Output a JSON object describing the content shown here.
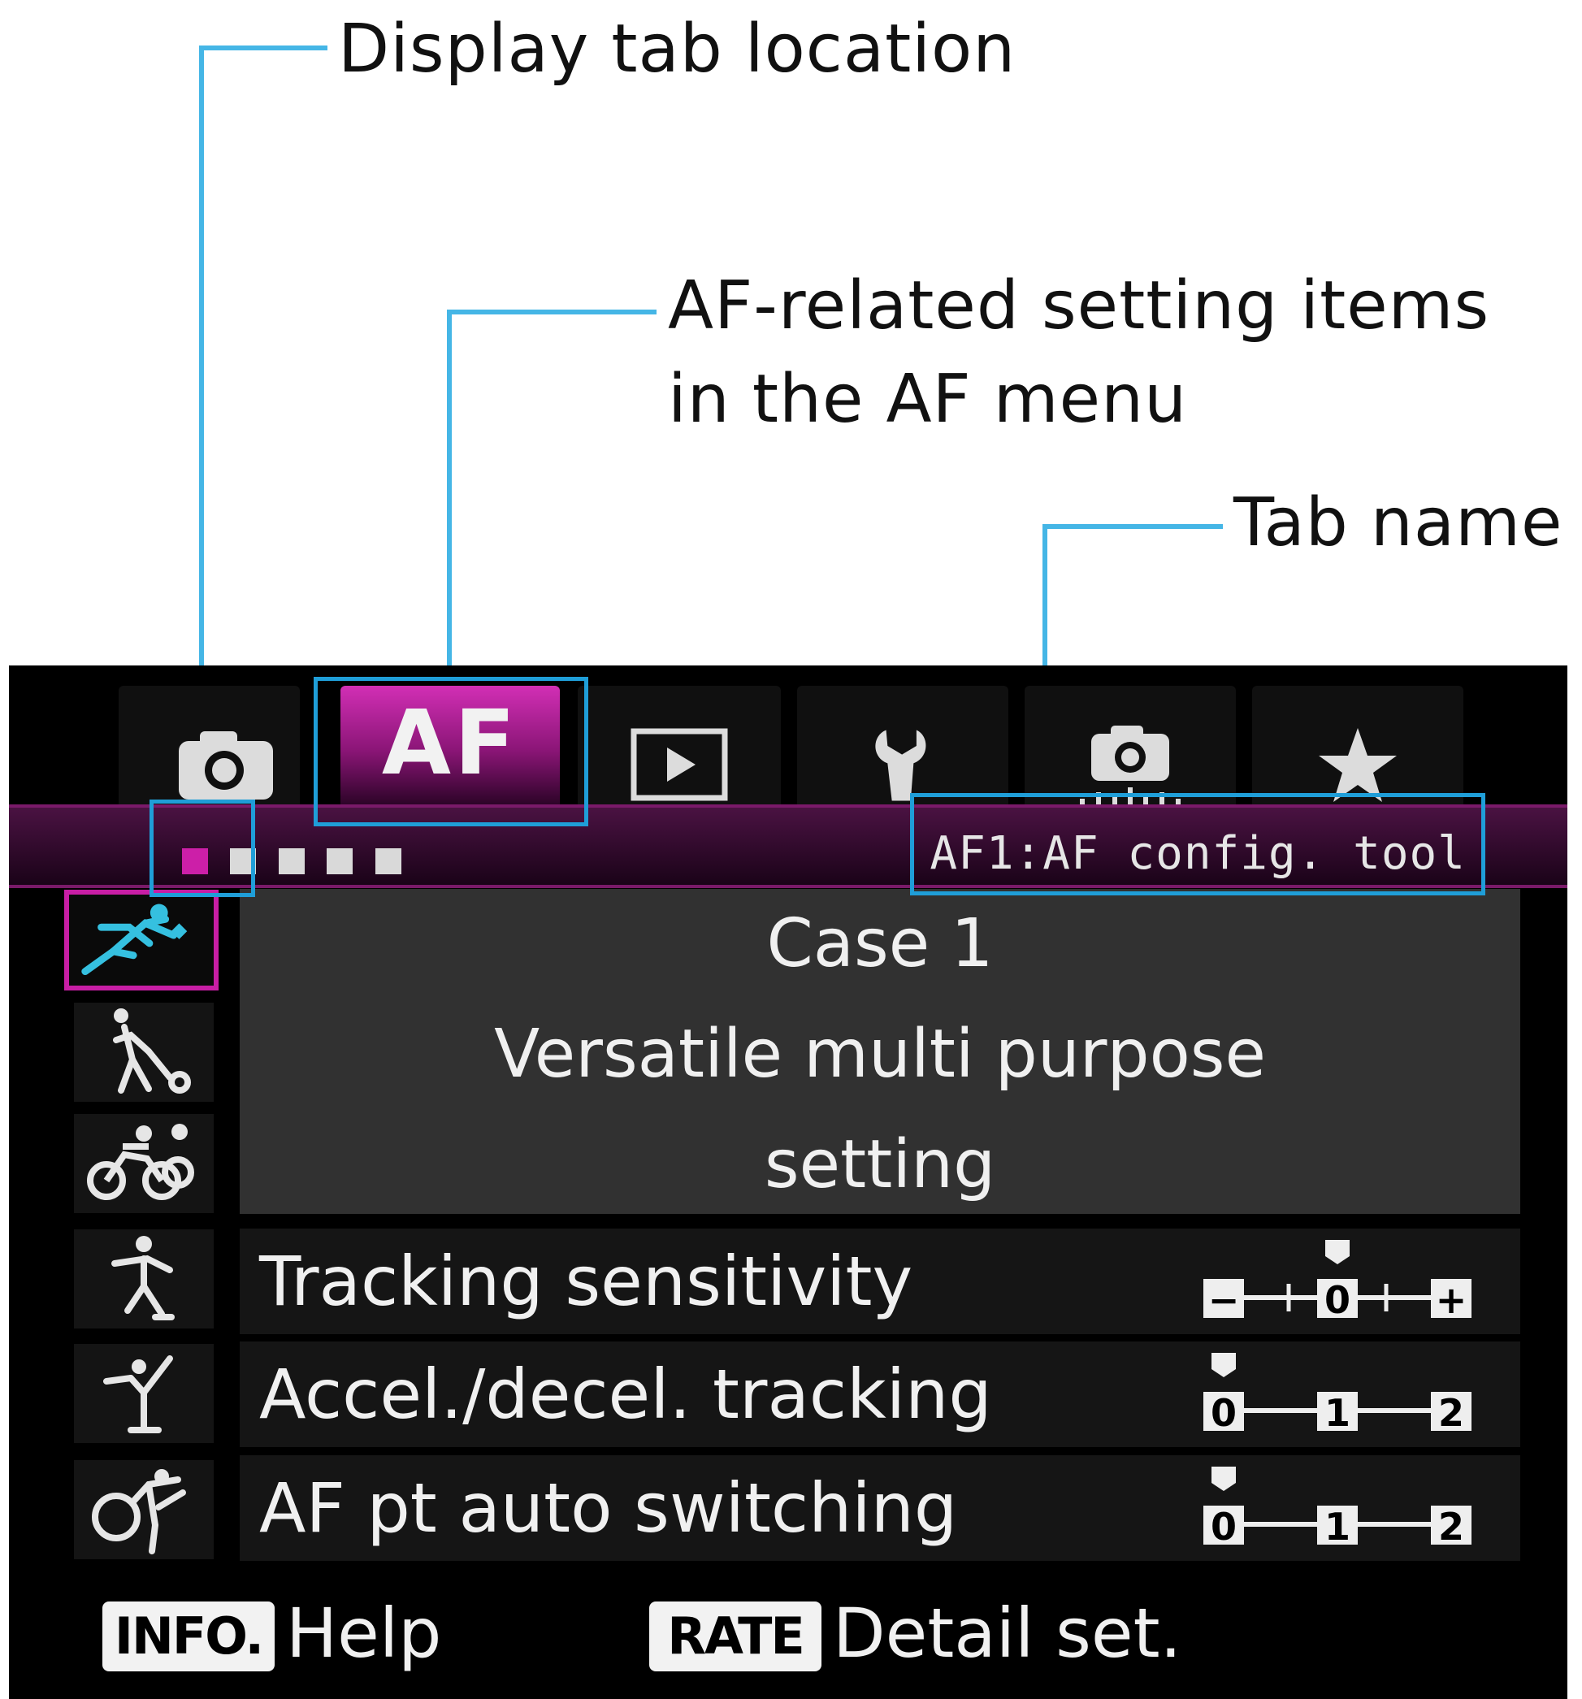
{
  "callouts": {
    "display_tab_location": "Display tab location",
    "af_items_line1": "AF-related setting items",
    "af_items_line2": "in the AF menu",
    "tab_name": "Tab name"
  },
  "colors": {
    "leader": "#45b6e6",
    "highlight_box": "#1f9ed8",
    "accent_magenta": "#c81ea5",
    "screen_bg": "#000000"
  },
  "tabs": [
    {
      "icon": "camera-icon",
      "active": false
    },
    {
      "label": "AF",
      "active": true
    },
    {
      "icon": "play-icon",
      "active": false
    },
    {
      "icon": "wrench-icon",
      "active": false
    },
    {
      "icon": "custom-camera-icon",
      "active": false
    },
    {
      "icon": "star-icon",
      "active": false
    }
  ],
  "tab_name": "AF1:AF config. tool",
  "pages": {
    "count": 5,
    "current": 1
  },
  "cases": [
    {
      "icon": "runner-case1-icon",
      "selected": true
    },
    {
      "icon": "tennis-case2-icon",
      "selected": false
    },
    {
      "icon": "cyclists-case3-icon",
      "selected": false
    },
    {
      "icon": "skater-case4-icon",
      "selected": false
    },
    {
      "icon": "figure-skater-case5-icon",
      "selected": false
    },
    {
      "icon": "gymnast-case6-icon",
      "selected": false
    }
  ],
  "case_panel": {
    "title": "Case 1",
    "desc_line1": "Versatile multi purpose",
    "desc_line2": "setting"
  },
  "params": [
    {
      "label": "Tracking sensitivity",
      "ticks": [
        "−",
        "0",
        "+"
      ],
      "value": 0
    },
    {
      "label": "Accel./decel. tracking",
      "ticks": [
        "0",
        "1",
        "2"
      ],
      "value": 0
    },
    {
      "label": "AF pt auto switching",
      "ticks": [
        "0",
        "1",
        "2"
      ],
      "value": 0
    }
  ],
  "footer": {
    "info_badge": "INFO.",
    "info_text": "Help",
    "rate_badge": "RATE",
    "rate_text": "Detail set."
  }
}
